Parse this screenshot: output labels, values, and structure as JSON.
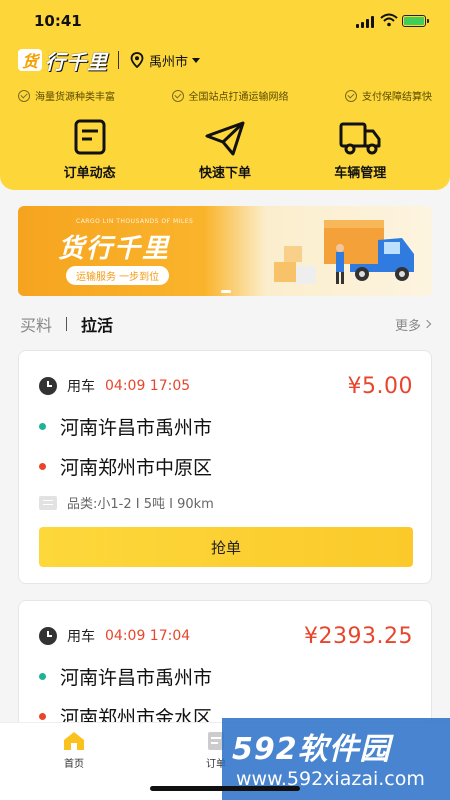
{
  "status_bar": {
    "time": "10:41"
  },
  "header": {
    "logo_mark": "货",
    "logo_text": "行千里",
    "city": "禹州市",
    "features": [
      "海量货源种类丰富",
      "全国站点打通运输网络",
      "支付保障结算快"
    ]
  },
  "quick_actions": [
    {
      "label": "订单动态",
      "icon": "order-doc-icon"
    },
    {
      "label": "快速下单",
      "icon": "paper-plane-icon"
    },
    {
      "label": "车辆管理",
      "icon": "truck-icon"
    }
  ],
  "banner": {
    "small_text": "CARGO LIN THOUSANDS OF MILES",
    "title": "货行千里",
    "subtitle": "运输服务 一步到位"
  },
  "tabs": {
    "items": [
      "买料",
      "拉活"
    ],
    "active": "拉活",
    "more": "更多"
  },
  "orders": [
    {
      "use_label": "用车",
      "time": "04:09 17:05",
      "price": "¥5.00",
      "from": "河南许昌市禹州市",
      "to": "河南郑州市中原区",
      "goods": "品类:小1-2 I 5吨 I 90km",
      "button": "抢单"
    },
    {
      "use_label": "用车",
      "time": "04:09 17:04",
      "price": "¥2393.25",
      "from": "河南许昌市禹州市",
      "to": "河南郑州市金水区"
    }
  ],
  "tabbar": {
    "items": [
      "首页",
      "订单"
    ]
  },
  "watermark": {
    "brand": "592软件园",
    "url": "www.592xiazai.com"
  },
  "colors": {
    "primary_yellow": "#fdd73a",
    "price_red": "#e8462c",
    "route_green": "#1fb396"
  }
}
